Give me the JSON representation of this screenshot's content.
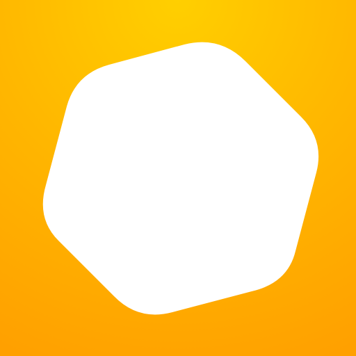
{
  "icon": {
    "name": "app-icon",
    "shape": "rounded-hexagon",
    "colors": {
      "background_top": "#FFCF00",
      "background_mid": "#FFB600",
      "background_bottom": "#FFA000",
      "shape_fill": "#FFFFFF"
    }
  }
}
